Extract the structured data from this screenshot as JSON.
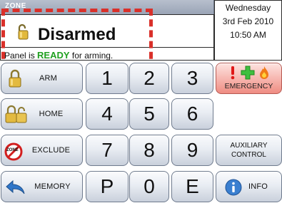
{
  "zone_bar": {
    "label": "ZONE"
  },
  "status": {
    "title": "Disarmed",
    "line_prefix": "Panel is",
    "line_highlight": "READY",
    "line_suffix": "for arming.",
    "ready_color": "#20a020",
    "icon": "lock-open-icon"
  },
  "datetime": {
    "weekday": "Wednesday",
    "date": "3rd Feb 2010",
    "time": "10:50 AM"
  },
  "keypad": {
    "left_buttons": [
      {
        "label": "ARM",
        "icon": "padlock-icon"
      },
      {
        "label": "HOME",
        "icon": "padlock-pair-icon"
      },
      {
        "label": "EXCLUDE",
        "icon": "zone-exclude-icon",
        "icon_text": "ZONE"
      },
      {
        "label": "MEMORY",
        "icon": "back-arrow-icon"
      }
    ],
    "digits": [
      "1",
      "2",
      "3",
      "4",
      "5",
      "6",
      "7",
      "8",
      "9",
      "P",
      "0",
      "E"
    ],
    "right_buttons": {
      "emergency": {
        "label": "EMERGENCY",
        "icons": [
          "exclamation-icon",
          "medical-cross-icon",
          "fire-icon"
        ]
      },
      "auxiliary": {
        "label_line1": "AUXILIARY",
        "label_line2": "CONTROL"
      },
      "info": {
        "label": "INFO",
        "icon": "info-icon"
      }
    }
  },
  "colors": {
    "button_border": "#6f7b8e",
    "emergency_bg": "#f6b3ac",
    "highlight_dash": "#d9302a"
  }
}
